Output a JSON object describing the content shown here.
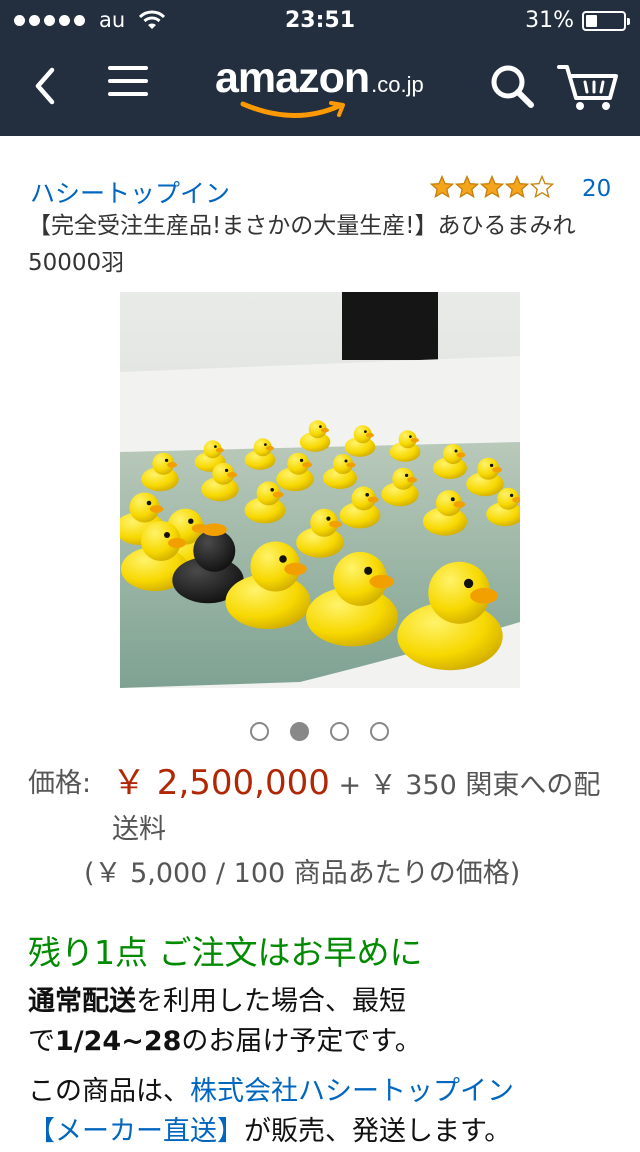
{
  "status_bar": {
    "carrier": "au",
    "time": "23:51",
    "battery": "31%",
    "battery_level": 0.31
  },
  "nav": {
    "logo_word": "amazon",
    "logo_tld": ".co.jp",
    "icons": [
      "back-arrow-icon",
      "menu-icon",
      "search-icon",
      "cart-icon"
    ],
    "bar_color": "#232f3e",
    "logo_smile_color": "#f90"
  },
  "product": {
    "brand": "ハシートップイン",
    "rating": 4,
    "rating_max": 5,
    "review_count": "20",
    "title": "【完全受注生産品!まさかの大量生産!】あひるまみれ50000羽",
    "image_pager": {
      "count": 4,
      "active_index": 1
    },
    "price_label": "価格:",
    "price": "￥ 2,500,000",
    "shipping": "+ ￥ 350 関東への配送料",
    "unit_price": "(￥ 5,000 / 100 商品あたりの価格)",
    "stock": "残り1点 ご注文はお早めに",
    "delivery": {
      "lead_bold": "通常配送",
      "lead_rest": "を利用した場合、最短",
      "prefix": "で",
      "date_bold": "1/24~28",
      "suffix": "のお届け予定です。"
    },
    "seller": {
      "prefix": "この商品は、",
      "seller_link": "株式会社ハシートップイン",
      "maker_link": "【メーカー直送】",
      "suffix": "が販売、発送します。"
    }
  }
}
